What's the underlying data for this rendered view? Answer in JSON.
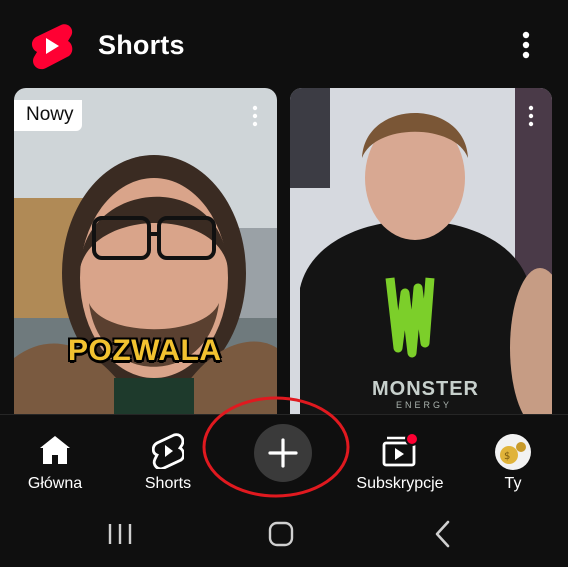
{
  "header": {
    "title": "Shorts",
    "logo_icon": "youtube-shorts-logo",
    "menu_icon": "more-vert-icon"
  },
  "feed": {
    "items": [
      {
        "badge": "Nowy",
        "overlay_text": "POZWALA"
      },
      {
        "overlay_text": "MONSTER",
        "overlay_subtext": "ENERGY"
      }
    ]
  },
  "bottom_nav": {
    "items": [
      {
        "label": "Główna",
        "icon": "home-icon"
      },
      {
        "label": "Shorts",
        "icon": "shorts-icon"
      },
      {
        "label": "",
        "icon": "create-plus-icon"
      },
      {
        "label": "Subskrypcje",
        "icon": "subscriptions-icon"
      },
      {
        "label": "Ty",
        "icon": "avatar"
      }
    ]
  },
  "system_nav": {
    "buttons": [
      "recent-apps",
      "home",
      "back"
    ]
  },
  "colors": {
    "brand_red": "#ff0033",
    "annotation_red": "#e0191f",
    "background": "#0f0f0f"
  }
}
